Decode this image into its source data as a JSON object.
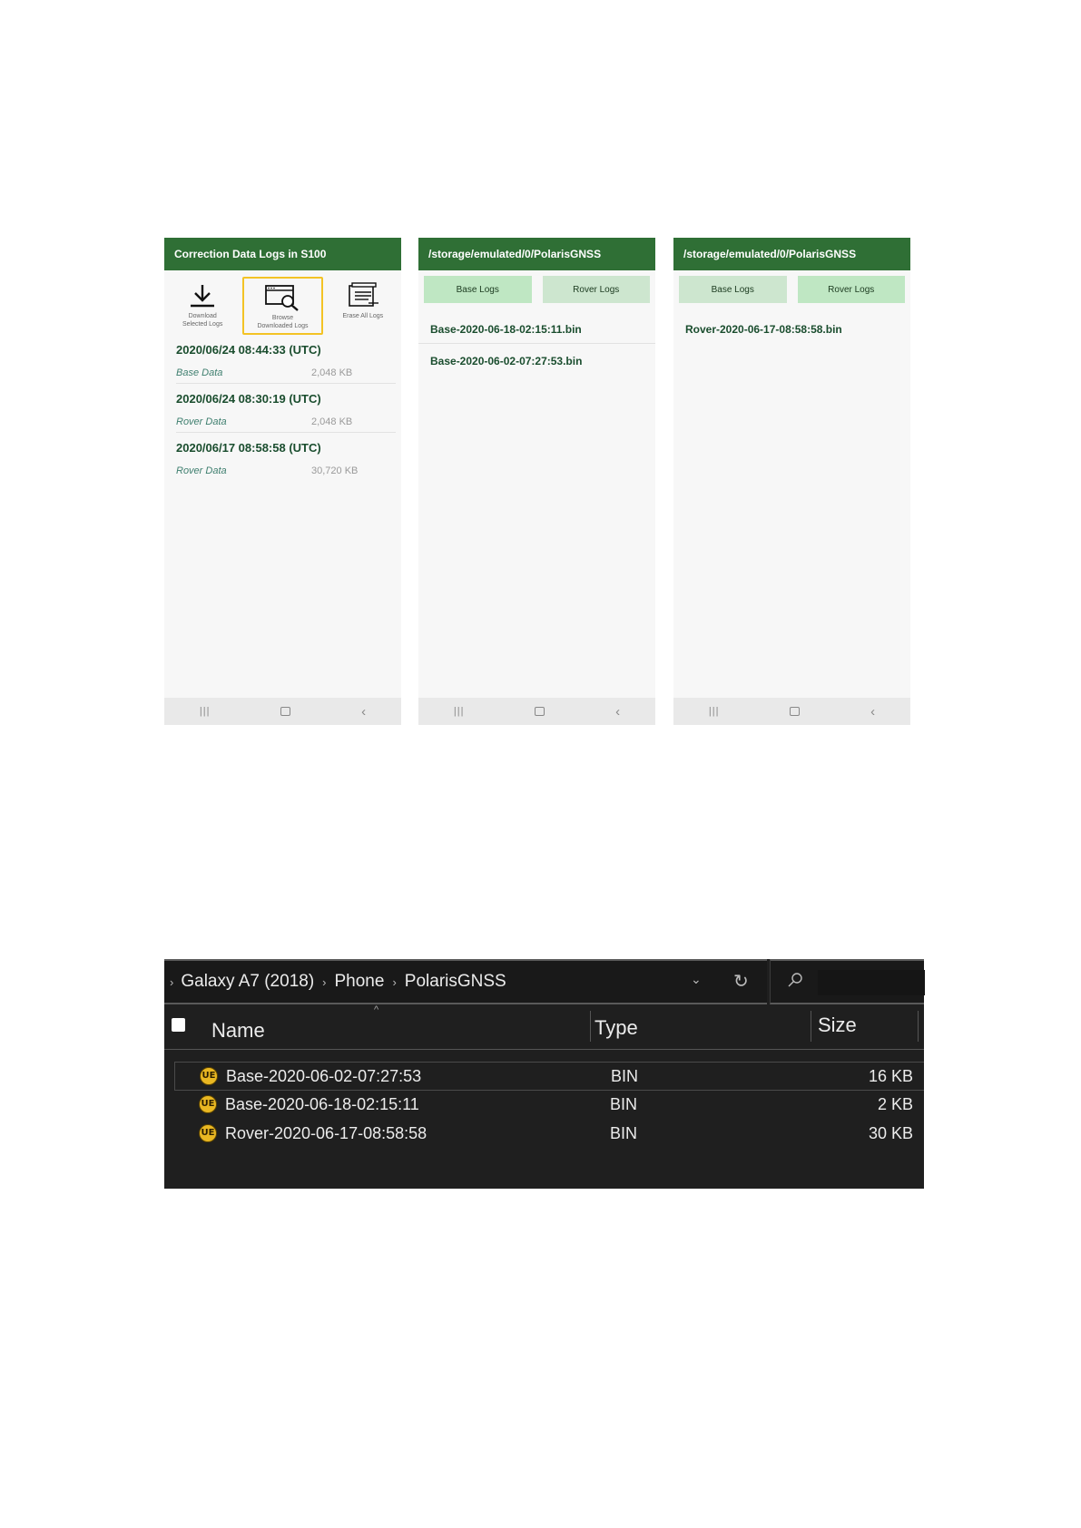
{
  "screen1": {
    "title": "Correction Data Logs in S100",
    "tools": [
      {
        "label1": "Download",
        "label2": "Selected Logs",
        "icon": "download-icon"
      },
      {
        "label1": "Browse",
        "label2": "Downloaded Logs",
        "icon": "browse-icon",
        "selected": true
      },
      {
        "label1": "Erase All Logs",
        "label2": "",
        "icon": "erase-icon"
      }
    ],
    "entries": [
      {
        "time": "2020/06/24 08:44:33 (UTC)",
        "kind": "Base Data",
        "size": "2,048 KB"
      },
      {
        "time": "2020/06/24 08:30:19 (UTC)",
        "kind": "Rover Data",
        "size": "2,048 KB"
      },
      {
        "time": "2020/06/17 08:58:58 (UTC)",
        "kind": "Rover Data",
        "size": "30,720 KB"
      }
    ]
  },
  "screen2": {
    "path": "/storage/emulated/0/PolarisGNSS",
    "tabs": [
      "Base Logs",
      "Rover Logs"
    ],
    "files": [
      "Base-2020-06-18-02:15:11.bin",
      "Base-2020-06-02-07:27:53.bin"
    ]
  },
  "screen3": {
    "path": "/storage/emulated/0/PolarisGNSS",
    "tabs": [
      "Base Logs",
      "Rover Logs"
    ],
    "files": [
      "Rover-2020-06-17-08:58:58.bin"
    ]
  },
  "explorer": {
    "breadcrumb": [
      "Galaxy A7 (2018)",
      "Phone",
      "PolarisGNSS"
    ],
    "columns": {
      "name": "Name",
      "type": "Type",
      "size": "Size"
    },
    "files": [
      {
        "name": "Base-2020-06-02-07:27:53",
        "type": "BIN",
        "size": "16 KB",
        "icon": "ultraedit-icon"
      },
      {
        "name": "Base-2020-06-18-02:15:11",
        "type": "BIN",
        "size": "2 KB",
        "icon": "ultraedit-icon"
      },
      {
        "name": "Rover-2020-06-17-08:58:58",
        "type": "BIN",
        "size": "30 KB",
        "icon": "ultraedit-icon"
      }
    ],
    "file_icon_text": "UE"
  },
  "colors": {
    "header_green": "#2f6f35",
    "tab_green": "#cde6cf",
    "highlight": "#f3c325",
    "explorer_bg": "#1f1f1f"
  }
}
